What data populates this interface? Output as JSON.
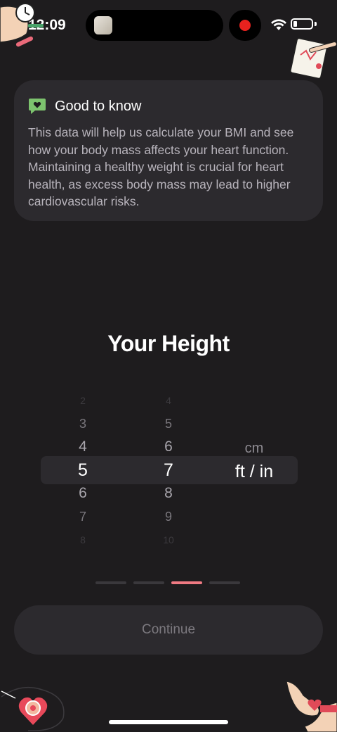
{
  "status_bar": {
    "time": "12:09",
    "icons": [
      "wifi-icon",
      "battery-icon",
      "screen-record-icon"
    ],
    "record_color": "#e8221e"
  },
  "info_card": {
    "title": "Good to know",
    "icon": "heart-chat-icon",
    "icon_color": "#7dc36e",
    "body": "This data will help us calculate your BMI and see how your body mass affects your heart function. Maintaining a healthy weight is crucial for heart health, as excess body mass may lead to higher cardiovascular risks."
  },
  "heading": "Your Height",
  "picker": {
    "feet": {
      "visible": [
        "2",
        "3",
        "4",
        "5",
        "6",
        "7",
        "8"
      ],
      "selected": "5"
    },
    "inches": {
      "visible": [
        "4",
        "5",
        "6",
        "7",
        "8",
        "9",
        "10"
      ],
      "selected": "7"
    },
    "units": {
      "options": [
        "cm",
        "ft / in"
      ],
      "selected": "ft / in"
    }
  },
  "progress": {
    "total_steps": 4,
    "current_step": 3,
    "active_color": "#f07a83"
  },
  "continue_button": {
    "label": "Continue",
    "enabled": false
  },
  "decorations": [
    "clock-hand-illustration",
    "notepad-pen-illustration",
    "heart-badge-illustration",
    "hands-heart-illustration"
  ]
}
